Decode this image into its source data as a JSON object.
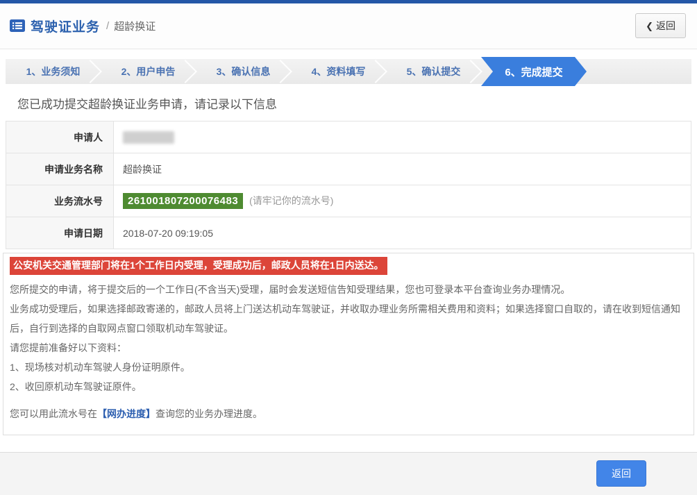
{
  "header": {
    "title": "驾驶证业务",
    "divider": "/",
    "subtitle": "超龄换证",
    "back_button": {
      "icon": "❮",
      "label": "返回"
    }
  },
  "steps": [
    {
      "label": "1、业务须知"
    },
    {
      "label": "2、用户申告"
    },
    {
      "label": "3、确认信息"
    },
    {
      "label": "4、资料填写"
    },
    {
      "label": "5、确认提交"
    },
    {
      "label": "6、完成提交"
    }
  ],
  "main": {
    "success_heading": "您已成功提交超龄换证业务申请，请记录以下信息",
    "info_table": {
      "rows": [
        {
          "label": "申请人",
          "value": "",
          "redacted": true
        },
        {
          "label": "申请业务名称",
          "value": "超龄换证"
        },
        {
          "label": "业务流水号",
          "value": "261001807200076483",
          "note": "(请牢记你的流水号)"
        },
        {
          "label": "申请日期",
          "value": "2018-07-20 09:19:05"
        }
      ]
    },
    "notice": {
      "alert": "公安机关交通管理部门将在1个工作日内受理，受理成功后，邮政人员将在1日内送达。",
      "paragraphs": [
        "您所提交的申请，将于提交后的一个工作日(不含当天)受理，届时会发送短信告知受理结果，您也可登录本平台查询业务办理情况。",
        "业务成功受理后，如果选择邮政寄递的，邮政人员将上门送达机动车驾驶证，并收取办理业务所需相关费用和资料；如果选择窗口自取的，请在收到短信通知后，自行到选择的自取网点窗口领取机动车驾驶证。",
        "请您提前准备好以下资料：",
        "1、现场核对机动车驾驶人身份证明原件。",
        "2、收回原机动车驾驶证原件。"
      ],
      "progress_line": {
        "prefix": "您可以用此流水号在",
        "link": "【网办进度】",
        "suffix": "查询您的业务办理进度。"
      }
    }
  },
  "footer": {
    "back_button": "返回"
  },
  "colors": {
    "topbar_blue": "#2457a7",
    "brand_blue": "#2c61ae",
    "step_text_blue": "#4a72b2",
    "active_step_blue": "#3a7edd",
    "badge_green": "#4e8b31",
    "alert_red": "#dc4539",
    "button_blue": "#4285e8"
  }
}
